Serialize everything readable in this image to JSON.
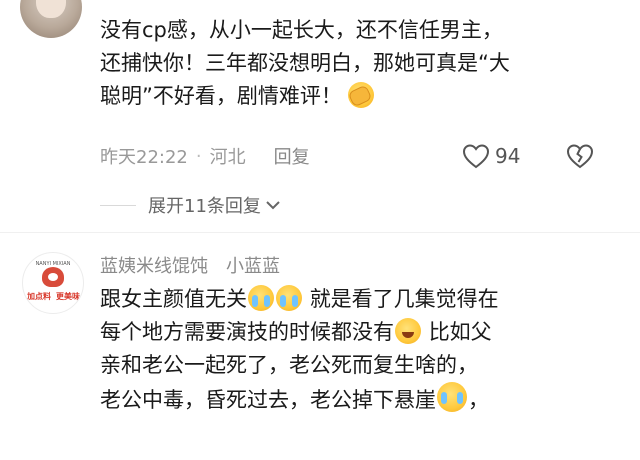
{
  "comment1": {
    "lines": [
      "没有cp感，从小一起长大，还不信任男主，",
      "还捕快你！三年都没想明白，那她可真是“大",
      "聪明”不好看，剧情难评！"
    ],
    "time": "昨天22:22",
    "separator": "·",
    "location": "河北",
    "reply": "回复",
    "likes": "94",
    "like_icon": "heart-outline-icon",
    "dislike_icon": "broken-heart-icon"
  },
  "expand": {
    "label": "展开11条回复"
  },
  "comment2": {
    "author": "蓝姨米线馄饨",
    "badge": "小蓝蓝",
    "avatar": {
      "subtitle": "NANYI MIXIAN",
      "tag_left": "加点料",
      "tag_right": "更美味"
    },
    "lines": {
      "l1a": "跟女主颜值无关",
      "l1b": "就是看了几集觉得在",
      "l2a": "每个地方需要演技的时候都没有",
      "l2b": "比如父",
      "l3": "亲和老公一起死了，老公死而复生啥的，",
      "l4a": "老公中毒，昏死过去，老公掉下悬崖",
      "l4b": "，"
    }
  },
  "colors": {
    "text": "#1a1a1a",
    "meta": "#999999",
    "author": "#8a8a8a",
    "shop_red": "#d8372a"
  }
}
